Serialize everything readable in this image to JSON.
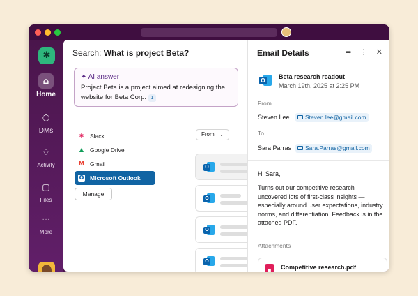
{
  "rail": {
    "items": [
      {
        "label": "Home",
        "icon": "home-icon"
      },
      {
        "label": "DMs",
        "icon": "chat-icon"
      },
      {
        "label": "Activity",
        "icon": "bell-icon"
      },
      {
        "label": "Files",
        "icon": "files-icon"
      },
      {
        "label": "More",
        "icon": "more-icon"
      }
    ]
  },
  "search": {
    "prefix": "Search:",
    "query": "What is project Beta?",
    "ai_title": "AI answer",
    "ai_text": "Project Beta is a project aimed at redesigning the website for Beta Corp.",
    "citation": "1",
    "sources": [
      "Slack",
      "Google Drive",
      "Gmail",
      "Microsoft Outlook"
    ],
    "active_source": "Microsoft Outlook",
    "manage_label": "Manage",
    "from_label": "From"
  },
  "email": {
    "header": "Email Details",
    "subject": "Beta research readout",
    "date": "March 19th, 2025 at 2:25 PM",
    "from_label": "From",
    "from_name": "Steven Lee",
    "from_email": "Steven.lee@gmail.com",
    "to_label": "To",
    "to_name": "Sara Parras",
    "to_email": "Sara.Parras@gmail.com",
    "greeting": "Hi Sara,",
    "body": "Turns out our competitive research uncovered lots of first-class insights — especially around user expectations, industry norms, and differentiation. Feedback is in the attached PDF.",
    "attachments_label": "Attachments",
    "attachment_name": "Competitive research.pdf"
  },
  "colors": {
    "aubergine": "#4a154b",
    "accent_blue": "#1164a3",
    "ai_purple": "#5b2a86"
  }
}
